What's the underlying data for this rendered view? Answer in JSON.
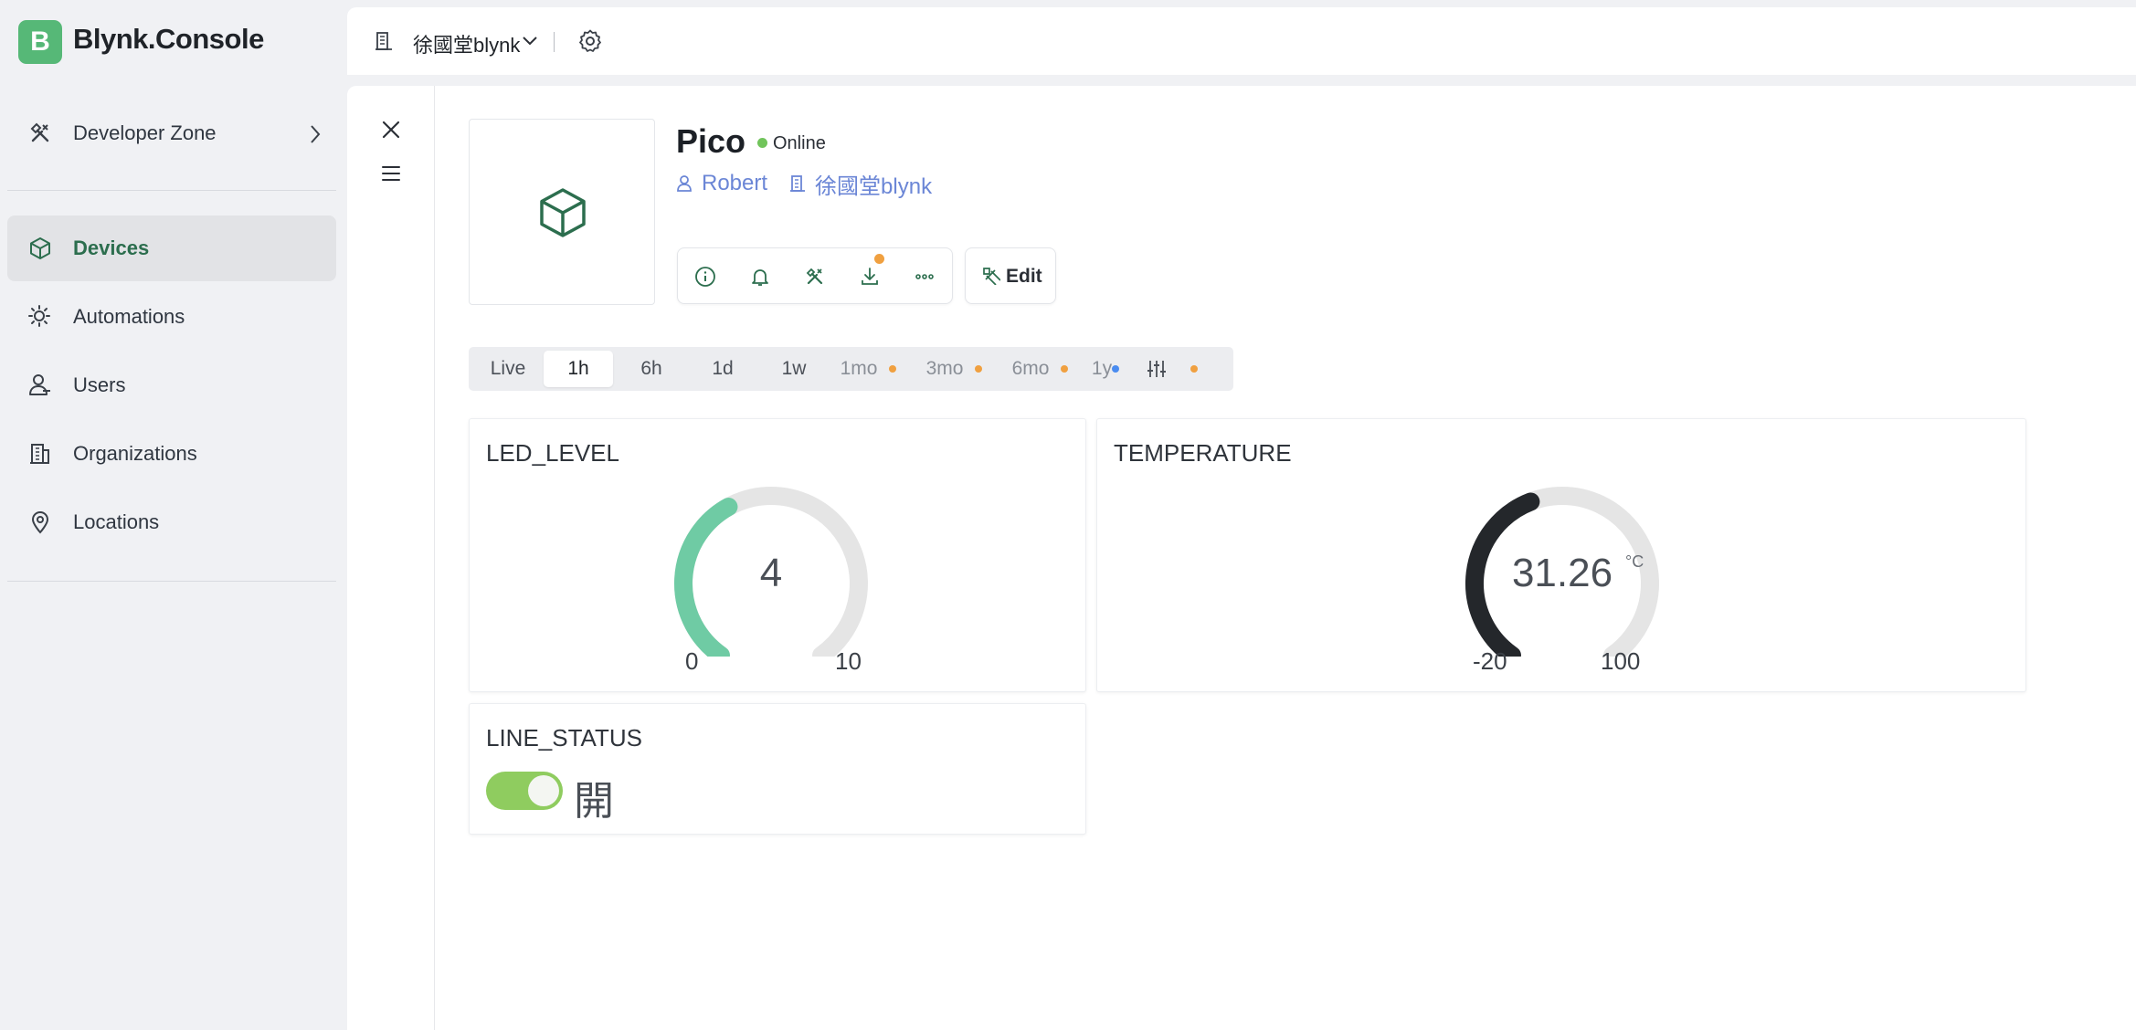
{
  "app": {
    "logo_letter": "B",
    "logo_text": "Blynk.Console",
    "brand_color": "#56b877"
  },
  "sidebar": {
    "items": [
      {
        "label": "Developer Zone",
        "icon": "tools-icon",
        "has_chevron": true
      },
      {
        "label": "Devices",
        "icon": "cube-icon",
        "active": true
      },
      {
        "label": "Automations",
        "icon": "automation-icon"
      },
      {
        "label": "Users",
        "icon": "users-icon"
      },
      {
        "label": "Organizations",
        "icon": "building-icon"
      },
      {
        "label": "Locations",
        "icon": "location-pin-icon"
      }
    ]
  },
  "topbar": {
    "org_name": "徐國堂blynk",
    "org_icon": "building-icon",
    "settings_icon": "gear-icon"
  },
  "device": {
    "name": "Pico",
    "status": "Online",
    "status_color": "#71c45b",
    "owner": "Robert",
    "organization": "徐國堂blynk",
    "actions": [
      "info-icon",
      "bell-icon",
      "tools-icon",
      "download-icon",
      "more-icon"
    ],
    "edit_label": "Edit"
  },
  "time_tabs": [
    {
      "label": "Live"
    },
    {
      "label": "1h",
      "selected": true
    },
    {
      "label": "6h"
    },
    {
      "label": "1d"
    },
    {
      "label": "1w"
    },
    {
      "label": "1mo",
      "dot": "#f0a040"
    },
    {
      "label": "3mo",
      "dot": "#f0a040"
    },
    {
      "label": "6mo",
      "dot": "#f0a040"
    },
    {
      "label": "1y",
      "dot": "#4a8cf0"
    },
    {
      "icon": "sliders-icon",
      "dot": "#f0a040"
    }
  ],
  "widgets": {
    "led_level": {
      "title": "LED_LEVEL",
      "value": "4",
      "min": "0",
      "max": "10",
      "fraction": 0.4,
      "color": "#6fcba4"
    },
    "temperature": {
      "title": "TEMPERATURE",
      "value": "31.26",
      "unit": "°C",
      "min": "-20",
      "max": "100",
      "fraction": 0.4272,
      "color": "#24272b"
    },
    "line_status": {
      "title": "LINE_STATUS",
      "state_label": "開",
      "on": true,
      "color": "#8fcc5f"
    }
  }
}
